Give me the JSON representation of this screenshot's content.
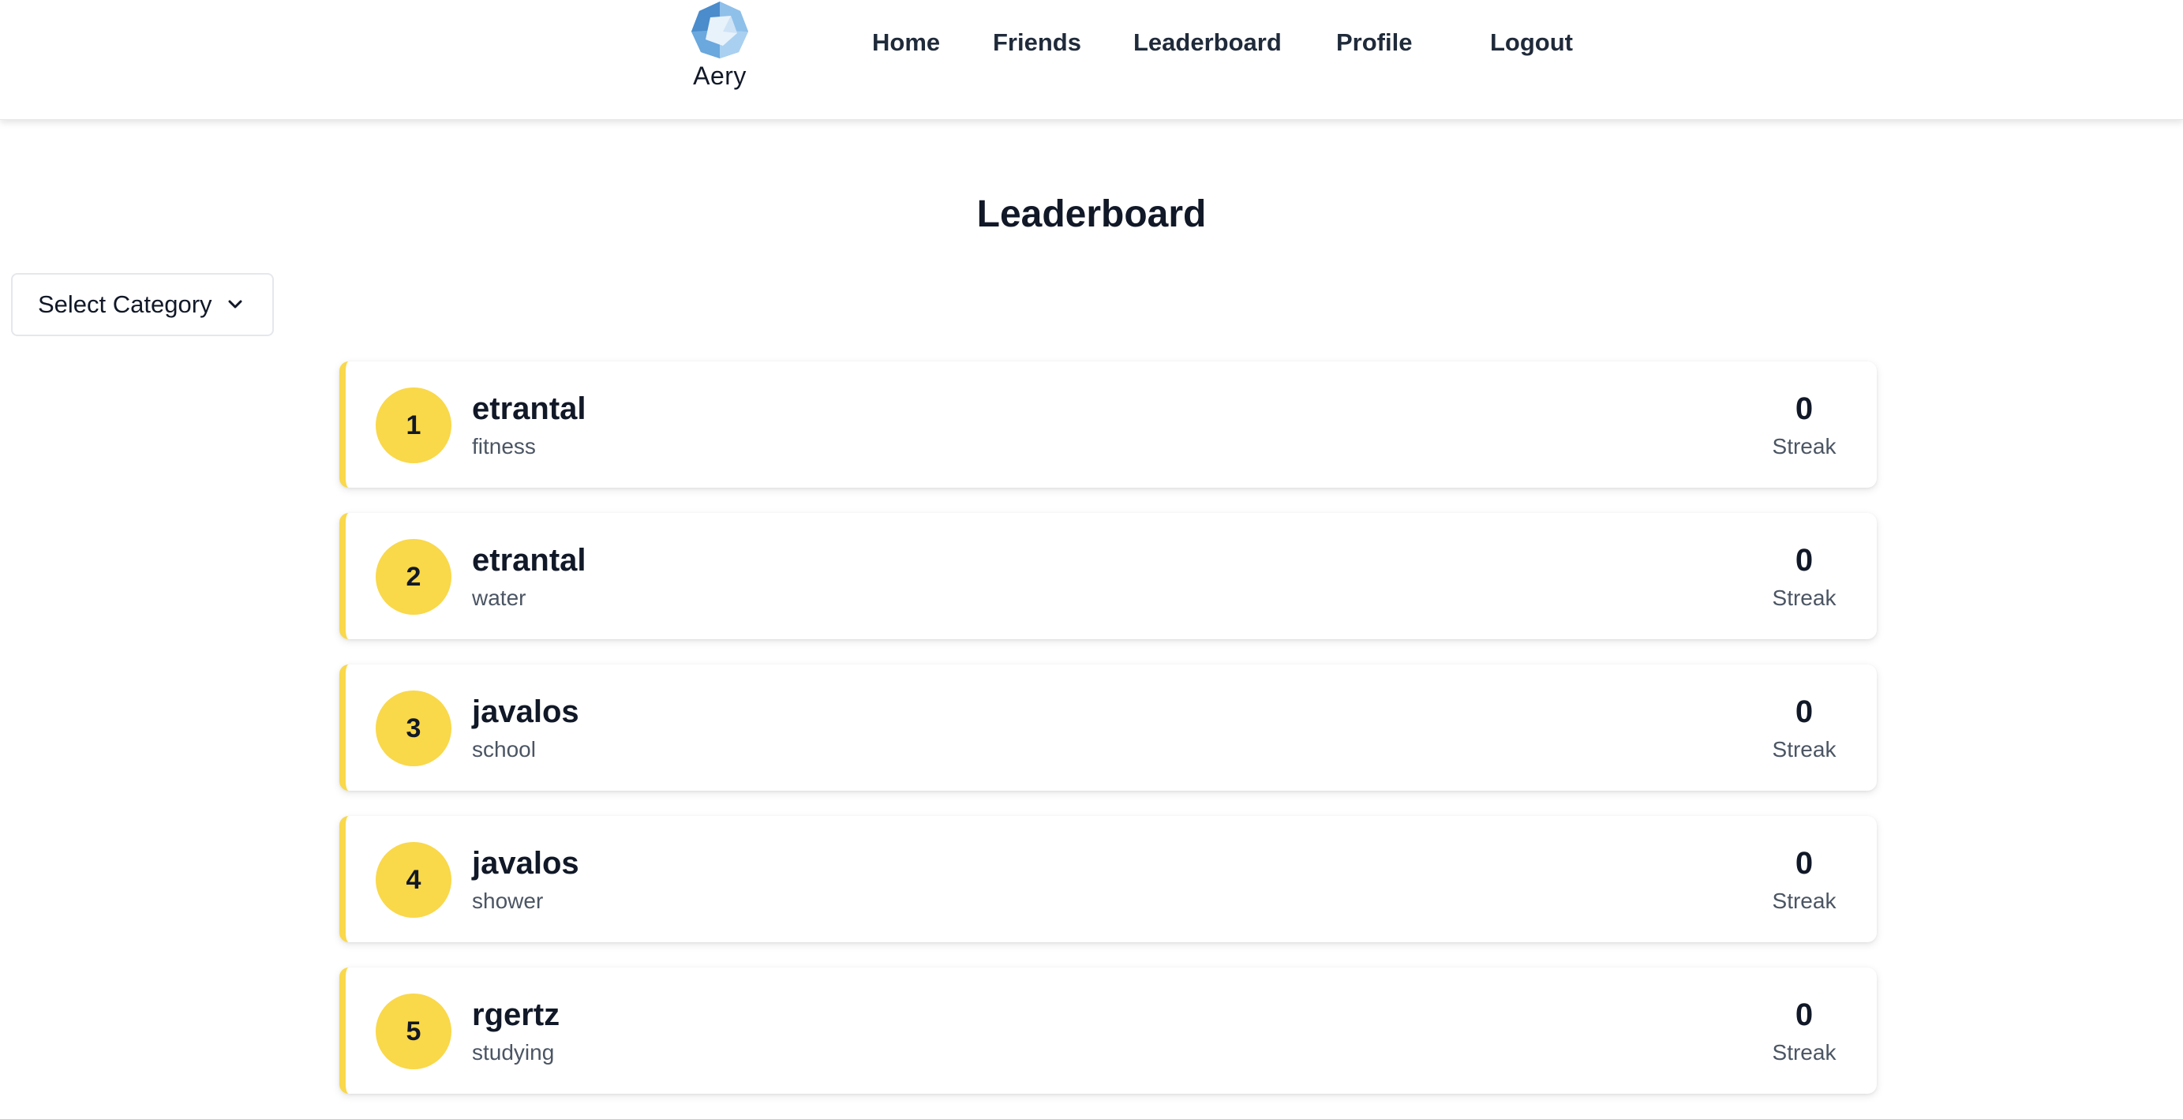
{
  "brand": {
    "name": "Aery",
    "logo_icon": "aery-logo-icon"
  },
  "nav": {
    "home": "Home",
    "friends": "Friends",
    "leaderboard": "Leaderboard",
    "profile": "Profile",
    "logout": "Logout"
  },
  "page": {
    "title": "Leaderboard"
  },
  "filter": {
    "label": "Select Category",
    "icon": "chevron-down-icon"
  },
  "colors": {
    "accent": "#f9d84a",
    "text": "#111827",
    "muted": "#4b5563"
  },
  "entries": [
    {
      "rank": "1",
      "user": "etrantal",
      "category": "fitness",
      "streak": "0",
      "streak_label": "Streak"
    },
    {
      "rank": "2",
      "user": "etrantal",
      "category": "water",
      "streak": "0",
      "streak_label": "Streak"
    },
    {
      "rank": "3",
      "user": "javalos",
      "category": "school",
      "streak": "0",
      "streak_label": "Streak"
    },
    {
      "rank": "4",
      "user": "javalos",
      "category": "shower",
      "streak": "0",
      "streak_label": "Streak"
    },
    {
      "rank": "5",
      "user": "rgertz",
      "category": "studying",
      "streak": "0",
      "streak_label": "Streak"
    }
  ]
}
